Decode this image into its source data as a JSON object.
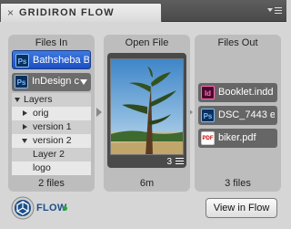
{
  "panel": {
    "title": "GRIDIRON FLOW",
    "close_glyph": "×"
  },
  "files_in": {
    "header": "Files In",
    "selected_file": {
      "label": "Bathsheba B...",
      "icon_letters": "Ps"
    },
    "document": {
      "label": "InDesign co...",
      "icon_letters": "Ps"
    },
    "layers": [
      {
        "label": "Layers",
        "state": "expanded",
        "indent": 0
      },
      {
        "label": "orig",
        "state": "collapsed",
        "indent": 1
      },
      {
        "label": "version 1",
        "state": "collapsed",
        "indent": 1
      },
      {
        "label": "version 2",
        "state": "expanded",
        "indent": 1
      },
      {
        "label": "Layer 2",
        "state": "none",
        "indent": 2
      },
      {
        "label": "logo",
        "state": "none",
        "indent": 2
      }
    ],
    "footer": "2 files"
  },
  "open_file": {
    "header": "Open File",
    "count": "3",
    "footer": "6m"
  },
  "files_out": {
    "header": "Files Out",
    "items": [
      {
        "label": "Booklet.indd",
        "icon_letters": "Id",
        "icon": "indesign-icon"
      },
      {
        "label": "DSC_7443 e...",
        "icon_letters": "Ps",
        "icon": "photoshop-icon"
      },
      {
        "label": "biker.pdf",
        "icon_letters": "PDF",
        "icon": "pdf-icon"
      }
    ],
    "footer": "3 files"
  },
  "footer": {
    "logo_text": "FLOW",
    "status_color": "#27a33a",
    "view_button_label": "View in Flow"
  },
  "colors": {
    "accent_blue": "#1b4fc4",
    "brand_blue": "#1b4f8a"
  }
}
